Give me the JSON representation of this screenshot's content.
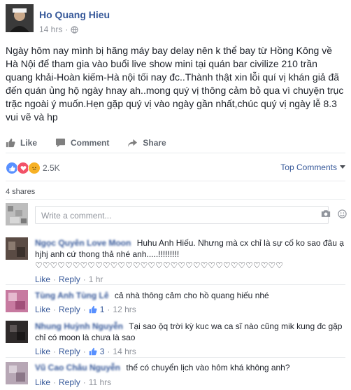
{
  "post": {
    "author": "Ho Quang Hieu",
    "time": "14 hrs",
    "body": "Ngày hôm nay mình bị hãng máy bay delay nên k thể bay từ Hồng Kông về Hà Nội để tham gia vào buổi live show mini tại quán bar civilize 210 trần quang khải-Hoàn kiếm-Hà nội tối nay đc..Thành thật xin lỗi quí vị khán giả đã đến quán ủng hộ ngày hnay ah..mong quý vị thông cảm bỏ qua vì chuyện trục trặc ngoài ý muốn.Hẹn gặp quý vị vào ngày gần nhất,chúc quý vị ngày lễ 8.3 vui vẽ và hp"
  },
  "actions": {
    "like": "Like",
    "comment": "Comment",
    "share": "Share"
  },
  "reactions": {
    "count": "2.5K",
    "sort_label": "Top Comments"
  },
  "shares": "4 shares",
  "comment_box": {
    "placeholder": "Write a comment..."
  },
  "comments": [
    {
      "name": "Ngọc Quyên Love Moon",
      "text": "Huhu Anh Hiếu. Nhưng mà cx chỉ là sự cố ko sao đâu ạ hjhj anh cứ thong thả nhé anh.....!!!!!!!!! ♡♡♡♡♡♡♡♡♡♡♡♡♡♡♡♡♡♡♡♡♡♡♡♡♡♡♡♡♡♡♡♡♡",
      "like": "Like",
      "reply": "Reply",
      "likes": "",
      "time": "1 hr"
    },
    {
      "name": "Tùng Anh Tùng Lê",
      "text": "cả nhà thông cảm cho hồ quang hiếu nhé",
      "like": "Like",
      "reply": "Reply",
      "likes": "1",
      "time": "12 hrs"
    },
    {
      "name": "Nhung Huỳnh Nguyễn",
      "text": "Tại sao ộq trời kỳ kuc wa ca sĩ nào cũng mik kung đc gặp chỉ có moon là chưa là sao",
      "like": "Like",
      "reply": "Reply",
      "likes": "3",
      "time": "14 hrs"
    },
    {
      "name": "Vũ Cao Châu Nguyễn",
      "text": "thế có chuyển lịch vào hôm khá không anh?",
      "like": "Like",
      "reply": "Reply",
      "likes": "",
      "time": "11 hrs"
    }
  ],
  "colors": {
    "link": "#365899",
    "meta": "#90949c",
    "like_blue": "#5890ff",
    "love_red": "#f25268",
    "sad_yellow": "#f7b125"
  }
}
